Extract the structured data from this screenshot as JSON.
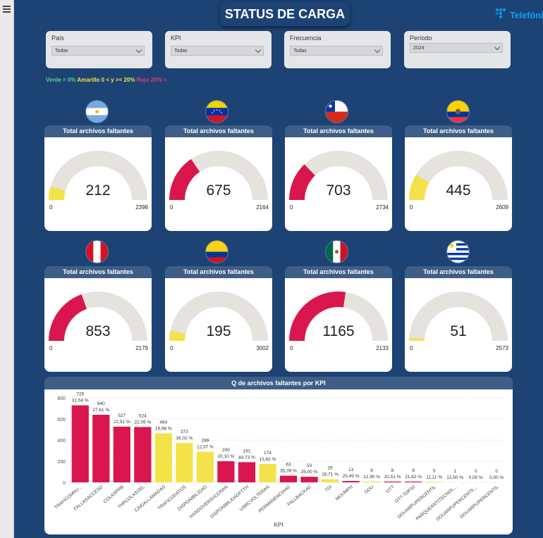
{
  "header": {
    "title": "STATUS DE CARGA",
    "logo_text": "Telefónica"
  },
  "filters": [
    {
      "label": "País",
      "value": "Todas"
    },
    {
      "label": "KPI",
      "value": "Todas"
    },
    {
      "label": "Frecuencia",
      "value": "Todas"
    },
    {
      "label": "Período",
      "value": "2024"
    }
  ],
  "threshold_legend": {
    "green": {
      "text": "Verde = 0%",
      "color": "#5fd08a"
    },
    "yellow": {
      "text": "Amarillo 0 < y >= 20%",
      "color": "#f5e33e"
    },
    "red": {
      "text": "Rojo 20% <",
      "color": "#e8366b"
    }
  },
  "colors": {
    "red": "#d9164d",
    "yellow": "#f4e24a",
    "track": "#e6e2de"
  },
  "gauges": [
    {
      "country_flag": "argentina-flag",
      "title": "Total archivos faltantes",
      "value": 212,
      "min": 0,
      "max": 2398,
      "color": "#f4e24a"
    },
    {
      "country_flag": "venezuela-flag",
      "title": "Total archivos faltantes",
      "value": 675,
      "min": 0,
      "max": 2164,
      "color": "#d9164d"
    },
    {
      "country_flag": "chile-flag",
      "title": "Total archivos faltantes",
      "value": 703,
      "min": 0,
      "max": 2734,
      "color": "#d9164d"
    },
    {
      "country_flag": "ecuador-flag",
      "title": "Total archivos faltantes",
      "value": 445,
      "min": 0,
      "max": 2609,
      "color": "#f4e24a"
    },
    {
      "country_flag": "peru-flag",
      "title": "Total archivos faltantes",
      "value": 853,
      "min": 0,
      "max": 2179,
      "color": "#d9164d"
    },
    {
      "country_flag": "colombia-flag",
      "title": "Total archivos faltantes",
      "value": 195,
      "min": 0,
      "max": 3002,
      "color": "#f4e24a"
    },
    {
      "country_flag": "mexico-flag",
      "title": "Total archivos faltantes",
      "value": 1165,
      "min": 0,
      "max": 2133,
      "color": "#d9164d"
    },
    {
      "country_flag": "uruguay-flag",
      "title": "Total archivos faltantes",
      "value": 51,
      "min": 0,
      "max": 2573,
      "color": "#f4e24a"
    }
  ],
  "chart_data": {
    "type": "bar",
    "title": "Q de archivos faltantes por KPI",
    "xlabel": "KPI",
    "ylabel": "",
    "ylim": [
      0,
      800
    ],
    "yticks": [
      0,
      200,
      400,
      600,
      800
    ],
    "grid": true,
    "categories": [
      "TRAFICOMNU...",
      "FALLASACCESO",
      "COLASPRB",
      "THPCOLASVEL",
      "CAIDALLAMADAS",
      "TRAFICODATOS",
      "DISPONIBILIDAD",
      "HANDOVERSVCCRAN",
      "DISPONIBILIDADFTTH",
      "USRCVOLTERAN",
      "PERMANENCIA4G",
      "FALLBACK4G",
      "TDI",
      "MOUMPH",
      "DOU",
      "OTT",
      "OTT-TOP10",
      "DOUARPUPERCENTIL",
      "PARQUEANTITECNOL...",
      "DOUARPUPERCENTIL...",
      "DOUARPUPERCENTIL"
    ],
    "values": [
      729,
      640,
      527,
      524,
      464,
      373,
      289,
      200,
      191,
      174,
      63,
      53,
      29,
      13,
      8,
      8,
      8,
      5,
      1,
      0,
      0
    ],
    "percent_labels": [
      "31,54 %",
      "27,61 %",
      "22,91 %",
      "22,09 %",
      "19,98 %",
      "16,02 %",
      "12,37 %",
      "20,10 %",
      "44,73 %",
      "13,62 %",
      "35,39 %",
      "25,00 %",
      "18,71 %",
      "25,49 %",
      "12,90 %",
      "20,51 %",
      "21,62 %",
      "11,11 %",
      "12,50 %",
      "0,00 %",
      "0,00 %"
    ],
    "bar_colors": [
      "#d9164d",
      "#d9164d",
      "#d9164d",
      "#d9164d",
      "#f4e24a",
      "#f4e24a",
      "#f4e24a",
      "#d9164d",
      "#d9164d",
      "#f4e24a",
      "#d9164d",
      "#d9164d",
      "#f4e24a",
      "#d9164d",
      "#f4e24a",
      "#d9164d",
      "#d9164d",
      "#f4e24a",
      "#f4e24a",
      "#5fd08a",
      "#5fd08a"
    ]
  }
}
